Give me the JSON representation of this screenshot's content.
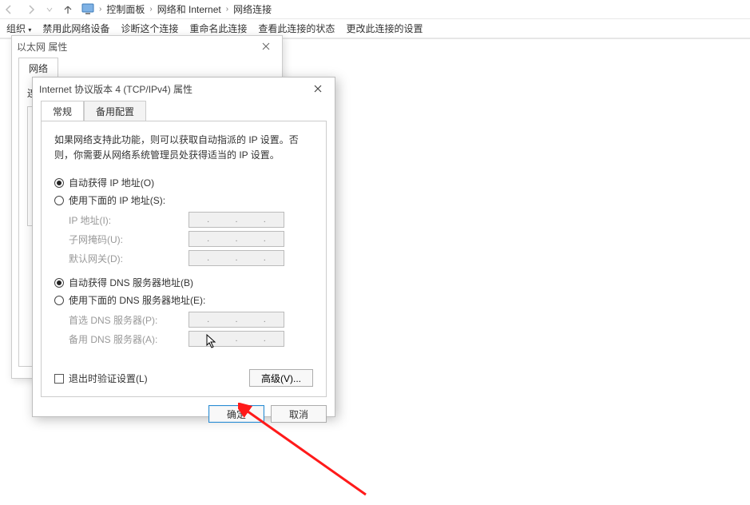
{
  "breadcrumb": {
    "nav_back": "←",
    "nav_fwd": "→",
    "nav_up": "↑",
    "items": [
      "控制面板",
      "网络和 Internet",
      "网络连接"
    ]
  },
  "toolbar": {
    "organize": "组织",
    "disable": "禁用此网络设备",
    "diagnose": "诊断这个连接",
    "rename": "重命名此连接",
    "status": "查看此连接的状态",
    "change": "更改此连接的设置"
  },
  "eth_window": {
    "title": "以太网 属性",
    "tab_network": "网络",
    "conn_label": "连"
  },
  "ipv4_dialog": {
    "title": "Internet 协议版本 4 (TCP/IPv4) 属性",
    "tab_general": "常规",
    "tab_alt": "备用配置",
    "description": "如果网络支持此功能，则可以获取自动指派的 IP 设置。否则，你需要从网络系统管理员处获得适当的 IP 设置。",
    "ip": {
      "auto_label": "自动获得 IP 地址(O)",
      "manual_label": "使用下面的 IP 地址(S):",
      "ip_label": "IP 地址(I):",
      "mask_label": "子网掩码(U):",
      "gw_label": "默认网关(D):",
      "selected": "auto"
    },
    "dns": {
      "auto_label": "自动获得 DNS 服务器地址(B)",
      "manual_label": "使用下面的 DNS 服务器地址(E):",
      "pref_label": "首选 DNS 服务器(P):",
      "alt_label": "备用 DNS 服务器(A):",
      "selected": "auto"
    },
    "validate_label": "退出时验证设置(L)",
    "advanced_label": "高级(V)...",
    "ok_label": "确定",
    "cancel_label": "取消"
  }
}
